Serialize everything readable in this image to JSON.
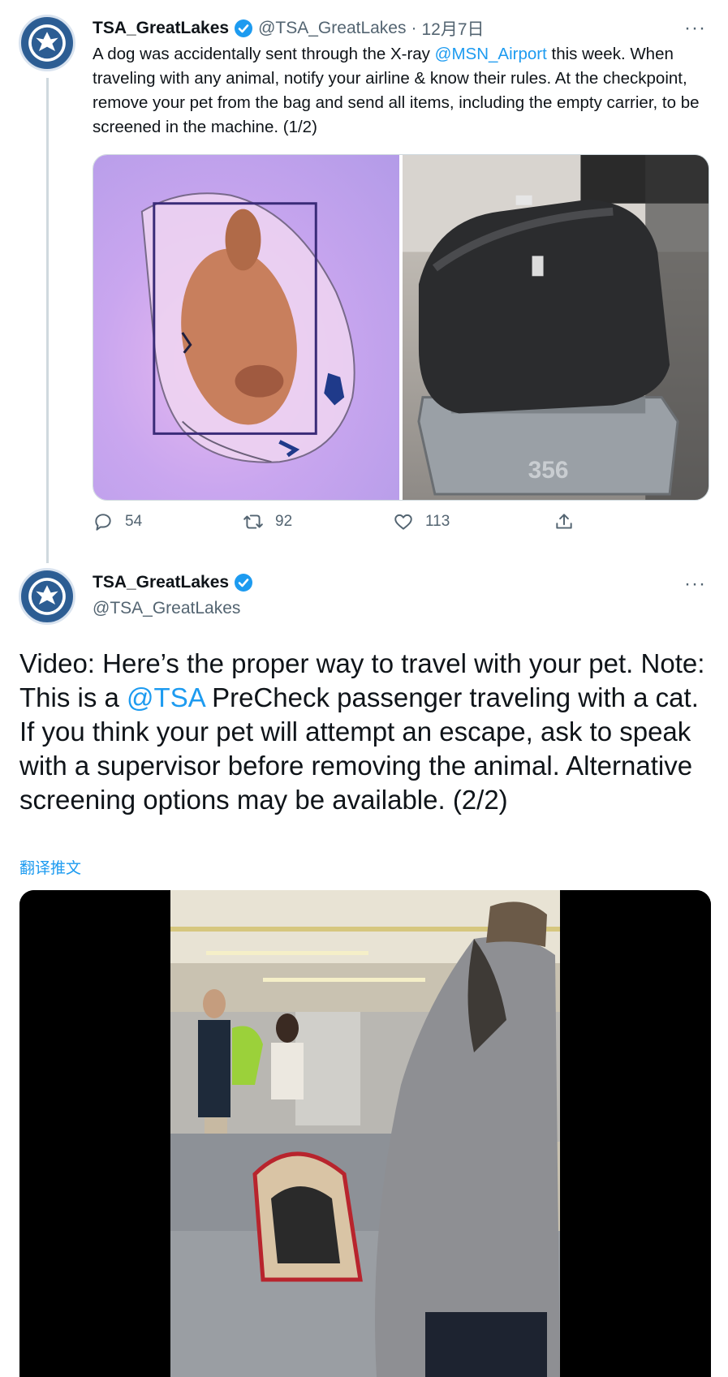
{
  "tweet1": {
    "display_name": "TSA_GreatLakes",
    "handle": "@TSA_GreatLakes",
    "separator": "·",
    "date": "12月7日",
    "more": "···",
    "text_before": "A dog was accidentally sent through the X-ray ",
    "mention": "@MSN_Airport",
    "text_after": " this week. When traveling with any animal, notify your airline & know their rules. At the checkpoint, remove your pet from the bag and send all items, including the empty carrier, to be screened in the machine. (1/2)",
    "replies": "54",
    "retweets": "92",
    "likes": "113",
    "x_ray_tray_number": "356"
  },
  "tweet2": {
    "display_name": "TSA_GreatLakes",
    "handle": "@TSA_GreatLakes",
    "more": "···",
    "text_before": "Video: Here’s the proper way to travel with your pet. Note: This is a ",
    "mention": "@TSA",
    "text_after": " PreCheck passenger traveling with a cat. If you think your pet will attempt an escape, ask to speak with a supervisor before removing the animal. Alternative screening options may be available. (2/2)",
    "translate": "翻译推文"
  },
  "icons": {
    "verified": "verified-badge-icon",
    "reply": "reply-icon",
    "retweet": "retweet-icon",
    "like": "heart-icon",
    "share": "share-icon"
  },
  "colors": {
    "link": "#1d9bf0",
    "muted": "#536471",
    "verified": "#1d9bf0",
    "text": "#0f1419"
  }
}
